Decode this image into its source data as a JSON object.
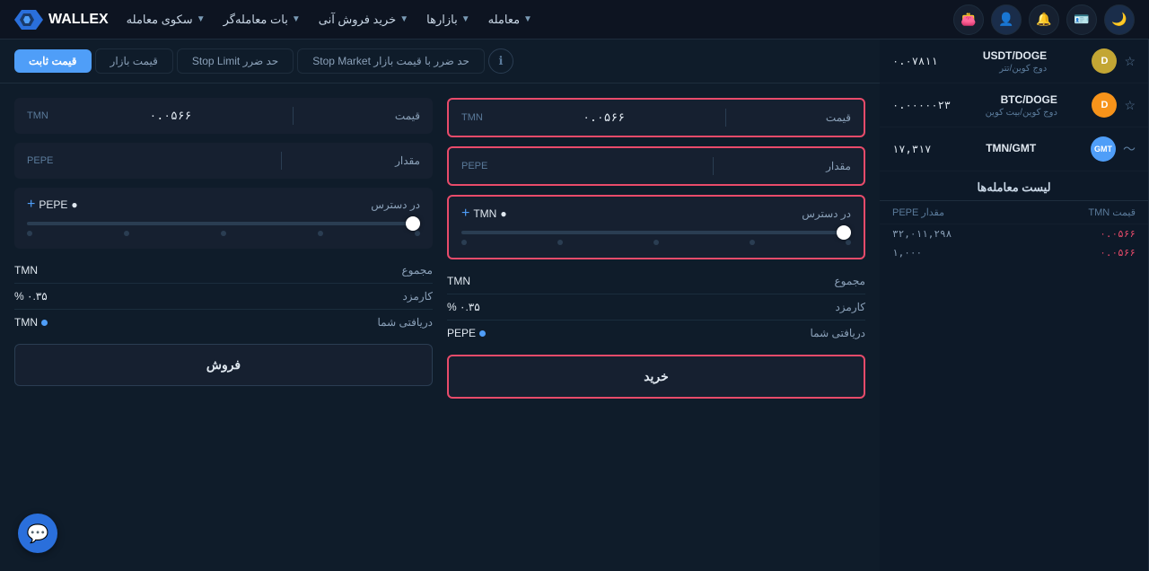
{
  "nav": {
    "logo_text": "WALLEX",
    "menu_items": [
      {
        "label": "معامله",
        "id": "trade"
      },
      {
        "label": "بازارها",
        "id": "markets"
      },
      {
        "label": "خرید فروش آنی",
        "id": "instant"
      },
      {
        "label": "بات معامله‌گر",
        "id": "bot"
      },
      {
        "label": "سکوی معامله",
        "id": "platform"
      }
    ],
    "icons": [
      {
        "name": "moon-icon",
        "symbol": "🌙",
        "active": true
      },
      {
        "name": "id-icon",
        "symbol": "🪪",
        "active": false
      },
      {
        "name": "bell-icon",
        "symbol": "🔔",
        "active": false
      },
      {
        "name": "user-icon",
        "symbol": "👤",
        "active": true
      },
      {
        "name": "wallet-icon",
        "symbol": "👛",
        "active": false
      }
    ]
  },
  "sidebar": {
    "pairs": [
      {
        "name": "USDT/DOGE",
        "desc": "دوج کوین/تتر",
        "price": "۰.۰۷۸۱۱",
        "icon": "D",
        "color": "doge-color"
      },
      {
        "name": "BTC/DOGE",
        "desc": "دوج کوین/بیت کوین",
        "price": "۰.۰۰۰۰۰۲۳",
        "icon": "D",
        "color": "btc-color"
      },
      {
        "name": "TMN/GMT",
        "desc": "",
        "price": "۱۷,۳۱۷",
        "icon": "G",
        "color": "gmt-color"
      }
    ],
    "list_header": "لیست معامله‌ها",
    "col_price": "قیمت TMN",
    "col_amount": "مقدار PEPE",
    "trades": [
      {
        "price": "۰.۰۵۶۶",
        "amount": "۳۲,۰۱۱,۲۹۸"
      },
      {
        "price": "۰.۰۵۶۶",
        "amount": "۱,۰۰۰"
      }
    ]
  },
  "tabs": [
    {
      "label": "قیمت ثابت",
      "active": true
    },
    {
      "label": "قیمت بازار",
      "active": false
    },
    {
      "label": "حد ضرر Stop Limit",
      "active": false
    },
    {
      "label": "حد ضرر با قیمت بازار Stop Market",
      "active": false
    }
  ],
  "buy_form": {
    "price_label": "قیمت",
    "price_currency": "TMN",
    "price_value": "۰.۰۵۶۶",
    "amount_label": "مقدار",
    "amount_currency": "PEPE",
    "amount_value": "",
    "available_label": "در دسترس",
    "available_currency": "TMN",
    "available_icon": "●",
    "total_label": "مجموع",
    "total_currency": "TMN",
    "fee_label": "کارمزد",
    "fee_value": "۰.۳۵ %",
    "receive_label": "دریافتی شما",
    "receive_currency": "PEPE",
    "receive_icon": "●",
    "submit_label": "خرید"
  },
  "sell_form": {
    "price_label": "قیمت",
    "price_currency": "TMN",
    "price_value": "۰.۰۵۶۶",
    "amount_label": "مقدار",
    "amount_currency": "PEPE",
    "amount_value": "",
    "available_label": "در دسترس",
    "available_currency": "PEPE",
    "available_icon": "●",
    "total_label": "مجموع",
    "total_currency": "TMN",
    "fee_label": "کارمزد",
    "fee_value": "۰.۳۵ %",
    "receive_label": "دریافتی شما",
    "receive_currency": "TMN",
    "receive_icon": "●",
    "submit_label": "فروش"
  },
  "chat": {
    "icon": "💬"
  }
}
